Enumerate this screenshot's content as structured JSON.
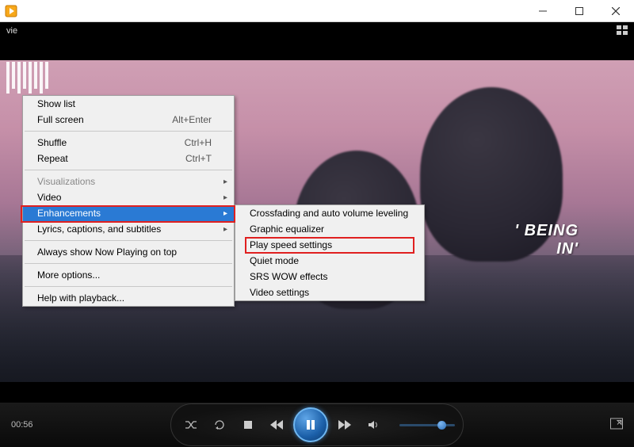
{
  "titlebar": {
    "app_name": ""
  },
  "subheader": {
    "label": "vie"
  },
  "video": {
    "caption_line1": "' BEING",
    "caption_line2": "IN'"
  },
  "playback": {
    "time_elapsed": "00:56"
  },
  "context_menu": {
    "show_list": "Show list",
    "full_screen": "Full screen",
    "full_screen_shortcut": "Alt+Enter",
    "shuffle": "Shuffle",
    "shuffle_shortcut": "Ctrl+H",
    "repeat": "Repeat",
    "repeat_shortcut": "Ctrl+T",
    "visualizations": "Visualizations",
    "video": "Video",
    "enhancements": "Enhancements",
    "lyrics": "Lyrics, captions, and subtitles",
    "always_on_top": "Always show Now Playing on top",
    "more_options": "More options...",
    "help_playback": "Help with playback..."
  },
  "enhancements_submenu": {
    "crossfading": "Crossfading and auto volume leveling",
    "graphic_eq": "Graphic equalizer",
    "play_speed": "Play speed settings",
    "quiet_mode": "Quiet mode",
    "srs_wow": "SRS WOW effects",
    "video_settings": "Video settings"
  }
}
